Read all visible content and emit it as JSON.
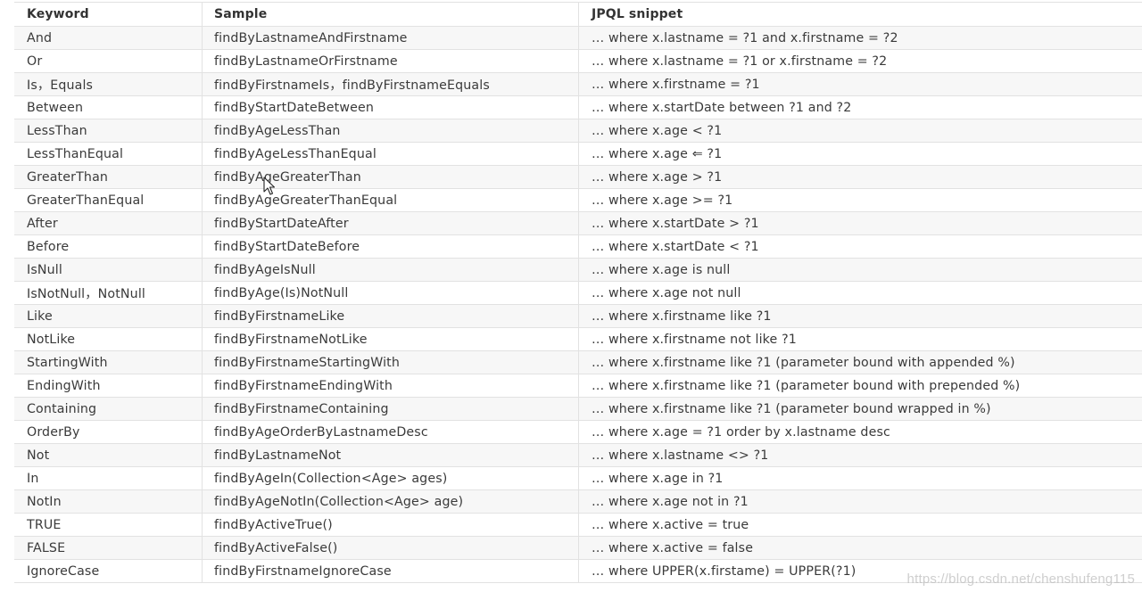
{
  "table": {
    "headers": {
      "keyword": "Keyword",
      "sample": "Sample",
      "jpql": "JPQL snippet"
    },
    "rows": [
      {
        "keyword": "And",
        "sample": "findByLastnameAndFirstname",
        "jpql": "… where x.lastname = ?1 and x.firstname = ?2"
      },
      {
        "keyword": "Or",
        "sample": "findByLastnameOrFirstname",
        "jpql": "… where x.lastname = ?1 or x.firstname = ?2"
      },
      {
        "keyword": "Is，Equals",
        "sample": "findByFirstnameIs，findByFirstnameEquals",
        "jpql": "… where x.firstname = ?1"
      },
      {
        "keyword": "Between",
        "sample": "findByStartDateBetween",
        "jpql": "… where x.startDate between ?1 and ?2"
      },
      {
        "keyword": "LessThan",
        "sample": "findByAgeLessThan",
        "jpql": "… where x.age < ?1"
      },
      {
        "keyword": "LessThanEqual",
        "sample": "findByAgeLessThanEqual",
        "jpql": "… where x.age ⇐ ?1"
      },
      {
        "keyword": "GreaterThan",
        "sample": "findByAgeGreaterThan",
        "jpql": "… where x.age > ?1"
      },
      {
        "keyword": "GreaterThanEqual",
        "sample": "findByAgeGreaterThanEqual",
        "jpql": "… where x.age >= ?1"
      },
      {
        "keyword": "After",
        "sample": "findByStartDateAfter",
        "jpql": "… where x.startDate > ?1"
      },
      {
        "keyword": "Before",
        "sample": "findByStartDateBefore",
        "jpql": "… where x.startDate < ?1"
      },
      {
        "keyword": "IsNull",
        "sample": "findByAgeIsNull",
        "jpql": "… where x.age is null"
      },
      {
        "keyword": "IsNotNull，NotNull",
        "sample": "findByAge(Is)NotNull",
        "jpql": "… where x.age not null"
      },
      {
        "keyword": "Like",
        "sample": "findByFirstnameLike",
        "jpql": "… where x.firstname like ?1"
      },
      {
        "keyword": "NotLike",
        "sample": "findByFirstnameNotLike",
        "jpql": "… where x.firstname not like ?1"
      },
      {
        "keyword": "StartingWith",
        "sample": "findByFirstnameStartingWith",
        "jpql": "… where x.firstname like ?1 (parameter bound with appended %)"
      },
      {
        "keyword": "EndingWith",
        "sample": "findByFirstnameEndingWith",
        "jpql": "… where x.firstname like ?1 (parameter bound with prepended %)"
      },
      {
        "keyword": "Containing",
        "sample": "findByFirstnameContaining",
        "jpql": "… where x.firstname like ?1 (parameter bound wrapped in %)"
      },
      {
        "keyword": "OrderBy",
        "sample": "findByAgeOrderByLastnameDesc",
        "jpql": "… where x.age = ?1 order by x.lastname desc"
      },
      {
        "keyword": "Not",
        "sample": "findByLastnameNot",
        "jpql": "… where x.lastname <> ?1"
      },
      {
        "keyword": "In",
        "sample": "findByAgeIn(Collection<Age> ages)",
        "jpql": "… where x.age in ?1"
      },
      {
        "keyword": "NotIn",
        "sample": "findByAgeNotIn(Collection<Age> age)",
        "jpql": "… where x.age not in ?1"
      },
      {
        "keyword": "TRUE",
        "sample": "findByActiveTrue()",
        "jpql": "… where x.active = true"
      },
      {
        "keyword": "FALSE",
        "sample": "findByActiveFalse()",
        "jpql": "… where x.active = false"
      },
      {
        "keyword": "IgnoreCase",
        "sample": "findByFirstnameIgnoreCase",
        "jpql": "… where UPPER(x.firstame) = UPPER(?1)"
      }
    ]
  },
  "watermark": "https://blog.csdn.net/chenshufeng115",
  "icons": {
    "cursor": "mouse-pointer-icon"
  },
  "colors": {
    "row_alt": "#f7f7f7",
    "row": "#ffffff",
    "border": "#e2e2e2",
    "text": "#3a3a3a"
  }
}
